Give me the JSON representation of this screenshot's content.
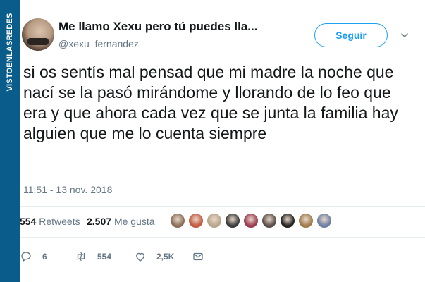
{
  "watermark": {
    "text": "VISTOENLASREDES"
  },
  "user": {
    "display_name": "Me llamo Xexu pero tú puedes lla...",
    "handle": "@xexu_fernandez"
  },
  "follow_button": {
    "label": "Seguir"
  },
  "tweet": {
    "text": "si os sentís mal pensad que mi madre la noche que nací se la pasó mirándome y llorando de lo feo que era y que ahora cada vez que se junta la familia hay alguien que me lo cuenta siempre",
    "timestamp": "11:51 - 13 nov. 2018"
  },
  "stats": {
    "retweets_count": "554",
    "retweets_label": "Retweets",
    "likes_count": "2.507",
    "likes_label": "Me gusta"
  },
  "likers": [
    {
      "name": "liker-avatar-1",
      "color": "#8a6f5a"
    },
    {
      "name": "liker-avatar-2",
      "color": "#c4593f"
    },
    {
      "name": "liker-avatar-3",
      "color": "#b9a58c"
    },
    {
      "name": "liker-avatar-4",
      "color": "#3a3a3a"
    },
    {
      "name": "liker-avatar-5",
      "color": "#9b3b52"
    },
    {
      "name": "liker-avatar-6",
      "color": "#5a4e48"
    },
    {
      "name": "liker-avatar-7",
      "color": "#222222"
    },
    {
      "name": "liker-avatar-8",
      "color": "#a07a4c"
    },
    {
      "name": "liker-avatar-9",
      "color": "#6d7fa6"
    }
  ],
  "actions": {
    "reply_count": "6",
    "retweet_count": "554",
    "like_count": "2,5K"
  },
  "colors": {
    "brand_blue": "#1da1f2",
    "muted_text": "#657786",
    "watermark_bg": "#0a5c8a"
  }
}
